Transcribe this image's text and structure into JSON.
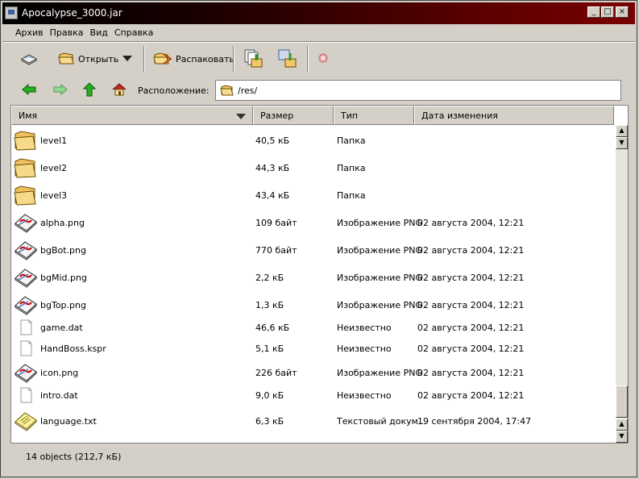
{
  "window": {
    "title": "Apocalypse_3000.jar",
    "controls": [
      "_",
      "□",
      "×"
    ]
  },
  "menu": [
    "Архив",
    "Правка",
    "Вид",
    "Справка"
  ],
  "toolbar": {
    "open_label": "Открыть",
    "extract_label": "Распаковать"
  },
  "nav": {
    "location_label": "Расположение:",
    "location_value": "/res/"
  },
  "columns": [
    "Имя",
    "Размер",
    "Тип",
    "Дата изменения"
  ],
  "files": [
    {
      "name": "level1",
      "size": "40,5 кБ",
      "type": "Папка",
      "date": "",
      "icon": "folder-icon"
    },
    {
      "name": "level2",
      "size": "44,3 кБ",
      "type": "Папка",
      "date": "",
      "icon": "folder-icon"
    },
    {
      "name": "level3",
      "size": "43,4 кБ",
      "type": "Папка",
      "date": "",
      "icon": "folder-icon"
    },
    {
      "name": "alpha.png",
      "size": "109 байт",
      "type": "Изображение PNG",
      "date": "02 августа 2004, 12:21",
      "icon": "image-icon"
    },
    {
      "name": "bgBot.png",
      "size": "770 байт",
      "type": "Изображение PNG",
      "date": "02 августа 2004, 12:21",
      "icon": "image-icon"
    },
    {
      "name": "bgMid.png",
      "size": "2,2 кБ",
      "type": "Изображение PNG",
      "date": "02 августа 2004, 12:21",
      "icon": "image-icon"
    },
    {
      "name": "bgTop.png",
      "size": "1,3 кБ",
      "type": "Изображение PNG",
      "date": "02 августа 2004, 12:21",
      "icon": "image-icon"
    },
    {
      "name": "game.dat",
      "size": "46,6 кБ",
      "type": "Неизвестно",
      "date": "02 августа 2004, 12:21",
      "icon": "file-icon"
    },
    {
      "name": "HandBoss.kspr",
      "size": "5,1 кБ",
      "type": "Неизвестно",
      "date": "02 августа 2004, 12:21",
      "icon": "file-icon"
    },
    {
      "name": "icon.png",
      "size": "226 байт",
      "type": "Изображение PNG",
      "date": "02 августа 2004, 12:21",
      "icon": "image-icon"
    },
    {
      "name": "intro.dat",
      "size": "9,0 кБ",
      "type": "Неизвестно",
      "date": "02 августа 2004, 12:21",
      "icon": "file-icon"
    },
    {
      "name": "language.txt",
      "size": "6,3 кБ",
      "type": "Текстовый докум...",
      "date": "19 сентября 2004, 17:47",
      "icon": "text-file-icon"
    }
  ],
  "status": {
    "text": "14 objects (212,7 кБ)"
  },
  "colors": {
    "title_start": "#000000",
    "title_end": "#7a0000",
    "chrome": "#d4d0c8"
  }
}
